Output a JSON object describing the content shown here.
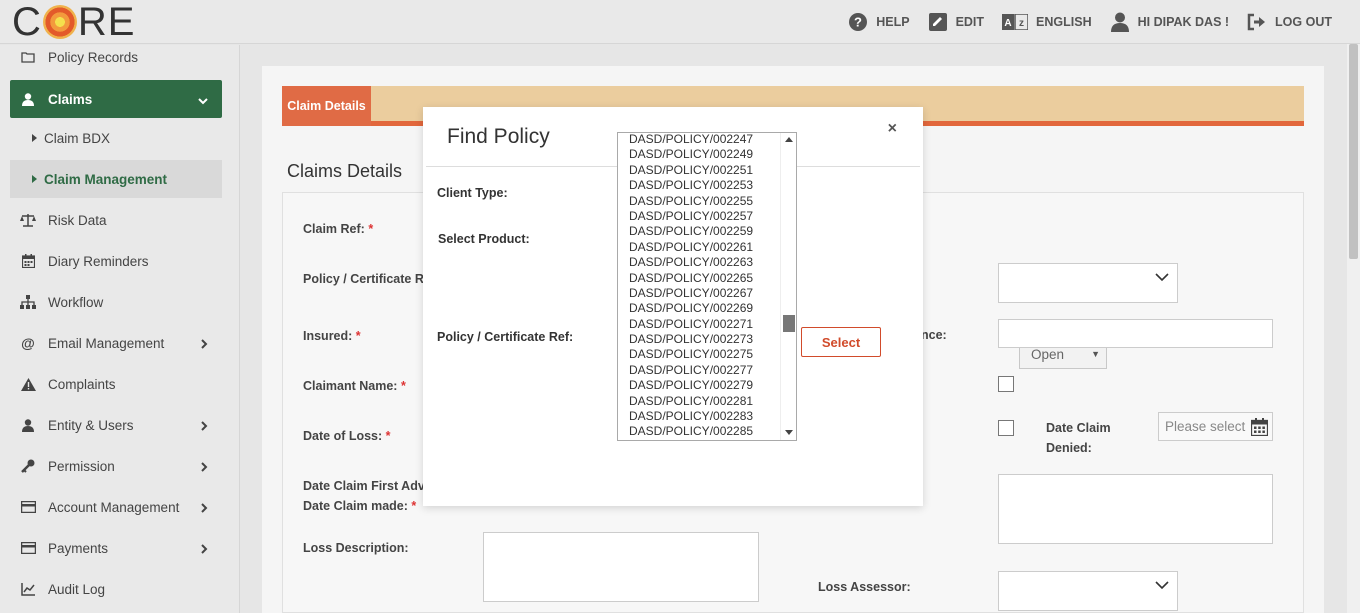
{
  "header": {
    "logo_text_1": "C",
    "logo_text_2": "RE",
    "nav": [
      {
        "label": "HELP",
        "icon": "help-icon"
      },
      {
        "label": "EDIT",
        "icon": "edit-icon"
      },
      {
        "label": "ENGLISH",
        "icon": "translate-icon"
      },
      {
        "label": "HI DIPAK DAS !",
        "icon": "user-icon"
      },
      {
        "label": "LOG OUT",
        "icon": "logout-icon"
      }
    ]
  },
  "sidebar": {
    "items": [
      {
        "label": "Policy Records"
      },
      {
        "label": "Claims"
      },
      {
        "label": "Claim BDX"
      },
      {
        "label": "Claim Management"
      },
      {
        "label": "Risk Data"
      },
      {
        "label": "Diary Reminders"
      },
      {
        "label": "Workflow"
      },
      {
        "label": "Email Management"
      },
      {
        "label": "Complaints"
      },
      {
        "label": "Entity & Users"
      },
      {
        "label": "Permission"
      },
      {
        "label": "Account Management"
      },
      {
        "label": "Payments"
      },
      {
        "label": "Audit Log"
      }
    ]
  },
  "main": {
    "tab_label": "Claim Details",
    "section_title": "Claims Details",
    "labels": {
      "claim_ref": "Claim Ref:",
      "policy_ref": "Policy / Certificate Re",
      "insured": "Insured:",
      "claimant_name": "Claimant Name:",
      "date_of_loss": "Date of Loss:",
      "date_first_advice": "Date Claim First Advi",
      "date_claim_made": "Date Claim made:",
      "loss_description": "Loss Description:",
      "reference_tail": "nce:",
      "date_claim_denied_1": "Date Claim",
      "date_claim_denied_2": "Denied:",
      "loss_assessor": "Loss Assessor:"
    },
    "required_mark": "*",
    "status_value": "Open",
    "date_placeholder": "Please select"
  },
  "modal": {
    "title": "Find Policy",
    "close": "×",
    "client_type_label": "Client Type:",
    "select_product_label": "Select Product:",
    "policy_ref_label": "Policy / Certificate Ref:",
    "select_button": "Select",
    "policies": [
      "DASD/POLICY/002247",
      "DASD/POLICY/002249",
      "DASD/POLICY/002251",
      "DASD/POLICY/002253",
      "DASD/POLICY/002255",
      "DASD/POLICY/002257",
      "DASD/POLICY/002259",
      "DASD/POLICY/002261",
      "DASD/POLICY/002263",
      "DASD/POLICY/002265",
      "DASD/POLICY/002267",
      "DASD/POLICY/002269",
      "DASD/POLICY/002271",
      "DASD/POLICY/002273",
      "DASD/POLICY/002275",
      "DASD/POLICY/002277",
      "DASD/POLICY/002279",
      "DASD/POLICY/002281",
      "DASD/POLICY/002283",
      "DASD/POLICY/002285"
    ]
  },
  "colors": {
    "sidebar_active": "#2f6b45",
    "tab_active": "#e06b45",
    "tab_bar": "#ebcd9e",
    "accent_button": "#d14b2b"
  }
}
